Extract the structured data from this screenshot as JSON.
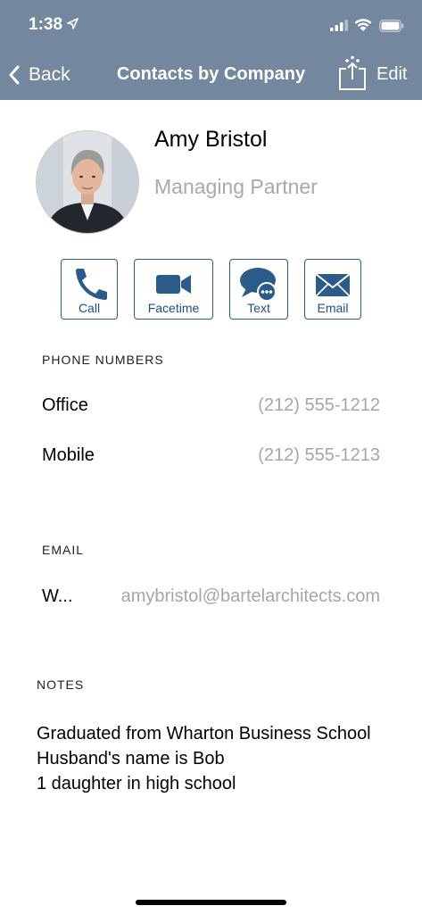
{
  "status_bar": {
    "time": "1:38"
  },
  "nav": {
    "back_label": "Back",
    "title": "Contacts by Company",
    "edit_label": "Edit"
  },
  "contact": {
    "name": "Amy Bristol",
    "title": "Managing Partner"
  },
  "actions": [
    {
      "label": "Call",
      "icon": "phone-icon"
    },
    {
      "label": "Facetime",
      "icon": "video-camera-icon"
    },
    {
      "label": "Text",
      "icon": "message-bubble-icon"
    },
    {
      "label": "Email",
      "icon": "envelope-icon"
    }
  ],
  "phone_section": {
    "label": "PHONE NUMBERS",
    "rows": [
      {
        "label": "Office",
        "value": "(212) 555-1212"
      },
      {
        "label": "Mobile",
        "value": "(212) 555-1213"
      }
    ]
  },
  "email_section": {
    "label": "EMAIL",
    "rows": [
      {
        "label": "W...",
        "value": "amybristol@bartelarchitects.com"
      }
    ]
  },
  "notes_section": {
    "label": "NOTES",
    "text": "Graduated from Wharton Business School\nHusband's name is Bob\n1 daughter in high school"
  },
  "colors": {
    "header": "#73879f",
    "accent": "#2b5b8a",
    "secondary_text": "#a3a6ab"
  }
}
